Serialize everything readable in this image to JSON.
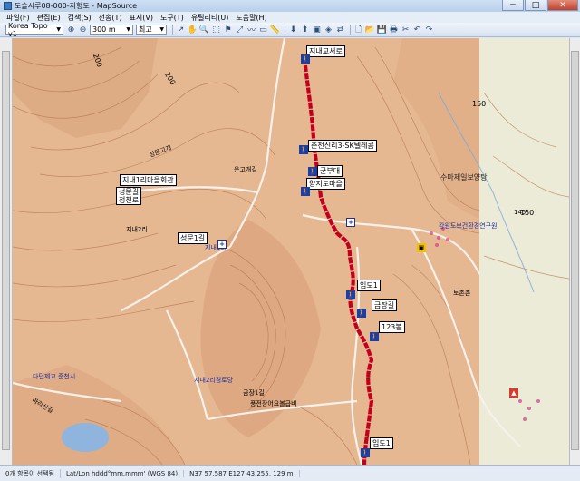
{
  "window": {
    "title": "도솔시루08-000-지형도 - MapSource",
    "controls": [
      "─",
      "□",
      "✕"
    ]
  },
  "menu": [
    "파일(F)",
    "편집(E)",
    "검색(S)",
    "전송(T)",
    "표시(V)",
    "도구(T)",
    "유틸리티(U)",
    "도움말(H)"
  ],
  "toolbar": {
    "map_product": "Korea Topo v1",
    "zoom_value": "300 m",
    "detail_value": "최고"
  },
  "map": {
    "contour_labels": [
      "200",
      "200",
      "150",
      "150"
    ],
    "place_labels": [
      {
        "text": "지내1리마을회관",
        "boxed": true
      },
      {
        "text": "성문길\n청천로",
        "boxed": true
      },
      {
        "text": "성문1길",
        "boxed": true
      },
      {
        "text": "지내교서로",
        "boxed": true
      },
      {
        "text": "춘천신리3-SK텔레콤",
        "boxed": true
      },
      {
        "text": "군부대",
        "boxed": true
      },
      {
        "text": "양지도마을",
        "boxed": true
      },
      {
        "text": "임도1",
        "boxed": true
      },
      {
        "text": "금장길",
        "boxed": true
      },
      {
        "text": "123봉",
        "boxed": true
      },
      {
        "text": "임도1",
        "boxed": true
      },
      {
        "text": "수마제일보양탕",
        "boxed": false
      },
      {
        "text": "강원도보건환경연구원",
        "boxed": false
      },
      {
        "text": "지내2리",
        "boxed": false
      },
      {
        "text": "지내3리",
        "boxed": false
      },
      {
        "text": "성문고개",
        "boxed": false
      },
      {
        "text": "은고개길",
        "boxed": false
      },
      {
        "text": "다던제교 준천시",
        "boxed": false
      },
      {
        "text": "마리산길",
        "boxed": false
      },
      {
        "text": "풍전장어요볼급벼",
        "boxed": false
      },
      {
        "text": "금장1길",
        "boxed": false
      },
      {
        "text": "토촌촌",
        "boxed": false
      },
      {
        "text": "지내2리경로당",
        "boxed": false
      },
      {
        "text": "145",
        "boxed": false
      }
    ]
  },
  "status": {
    "selection": "0개 항목이 선택됨",
    "coord_format": "Lat/Lon hddd°mm.mmm' (WGS 84)",
    "coords": "N37 57.587 E127 43.255, 129 m"
  }
}
